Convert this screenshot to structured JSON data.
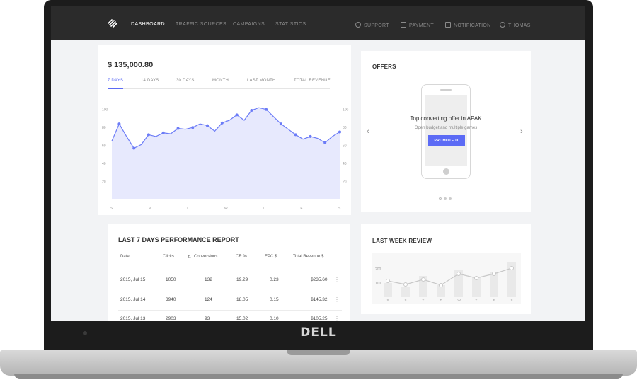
{
  "device": {
    "brand": "DELL"
  },
  "nav": {
    "items": [
      "Dashboard",
      "Traffic Sources",
      "Campaigns",
      "Statistics"
    ],
    "active": "Dashboard",
    "utility": [
      "Support",
      "Payment",
      "Notification",
      "Thomas"
    ]
  },
  "revenue": {
    "amount": "$ 135,000.80",
    "tabs": [
      "7 Days",
      "14 Days",
      "30 Days",
      "Month",
      "Last Month",
      "Total Revenue"
    ],
    "active_tab": "7 Days"
  },
  "chart_data": [
    {
      "type": "area",
      "x": [
        "S",
        "M",
        "T",
        "W",
        "T",
        "F",
        "S"
      ],
      "y_ticks": [
        20,
        40,
        60,
        80,
        100
      ],
      "ylim": [
        0,
        110
      ],
      "values": [
        65,
        84,
        70,
        57,
        61,
        72,
        70,
        74,
        73,
        79,
        78,
        80,
        84,
        82,
        76,
        85,
        88,
        94,
        88,
        99,
        102,
        100,
        92,
        84,
        78,
        72,
        67,
        70,
        68,
        63,
        70,
        75
      ],
      "color": "#6c7cf7",
      "fill": "#e7e9fd",
      "grid": false
    },
    {
      "type": "bar",
      "categories": [
        "S",
        "S",
        "T",
        "T",
        "W",
        "T",
        "F",
        "S"
      ],
      "values": [
        100,
        70,
        150,
        85,
        190,
        140,
        175,
        250
      ],
      "line": [
        115,
        90,
        125,
        85,
        165,
        135,
        165,
        205
      ],
      "y_ticks": [
        100,
        200
      ],
      "ylim": [
        0,
        290
      ],
      "bar_color": "#ececec",
      "line_color": "#c8c8c8"
    }
  ],
  "offers": {
    "title": "Offers",
    "headline": "Top converting offer in APAK",
    "subline": "Open budget and multiple games",
    "button": "Promote It",
    "prev": "‹",
    "next": "›"
  },
  "report": {
    "title": "Last 7 Days Performance Report",
    "columns": [
      "Date",
      "Clicks",
      "Conversions",
      "CR %",
      "EPC $",
      "Total Revenue $"
    ],
    "rows": [
      [
        "2015, Jul 15",
        "1050",
        "132",
        "19.29",
        "0.23",
        "$235.60"
      ],
      [
        "2015, Jul 14",
        "3940",
        "124",
        "18.05",
        "0.15",
        "$145.32"
      ],
      [
        "2015, Jul 13",
        "2903",
        "93",
        "15.02",
        "0.10",
        "$105.25"
      ]
    ]
  },
  "review": {
    "title": "Last Week Review"
  },
  "colors": {
    "accent": "#5c6bf5",
    "topbar": "#2b2b2b"
  }
}
